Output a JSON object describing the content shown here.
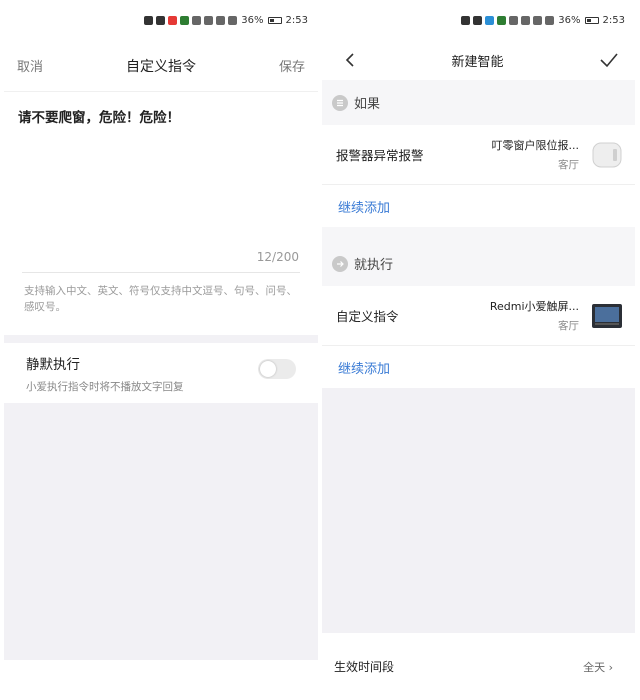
{
  "status_bar": {
    "battery": "36%",
    "time": "2:53"
  },
  "left": {
    "header": {
      "cancel": "取消",
      "title": "自定义指令",
      "save": "保存"
    },
    "command_text": "请不要爬窗，危险！危险！",
    "counter": "12/200",
    "hint": "支持输入中文、英文、符号仅支持中文逗号、句号、问号、感叹号。",
    "silent": {
      "title": "静默执行",
      "subtitle": "小爱执行指令时将不播放文字回复",
      "enabled": false
    }
  },
  "right": {
    "header": {
      "title": "新建智能"
    },
    "if_section": {
      "label": "如果",
      "rows": [
        {
          "name": "报警器异常报警",
          "device": "叮零窗户限位报...",
          "room": "客厅"
        }
      ],
      "add": "继续添加"
    },
    "then_section": {
      "label": "就执行",
      "rows": [
        {
          "name": "自定义指令",
          "device": "Redmi小爱触屏...",
          "room": "客厅"
        }
      ],
      "add": "继续添加"
    },
    "footer": {
      "label": "生效时间段",
      "value": "全天"
    }
  }
}
